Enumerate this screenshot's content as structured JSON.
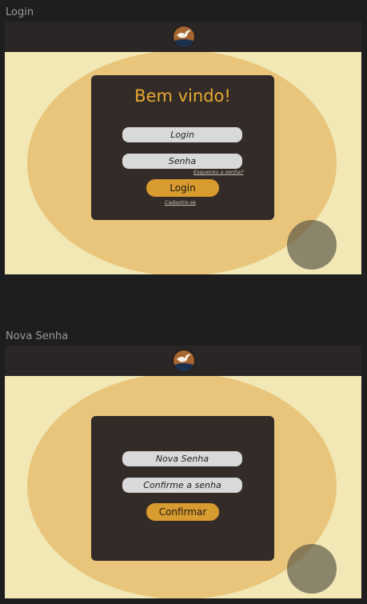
{
  "frames": [
    {
      "label": "Login",
      "card": {
        "title": "Bem vindo!",
        "login_placeholder": "Login",
        "password_placeholder": "Senha",
        "forgot_password": "Esqueceu a senha?",
        "login_button": "Login",
        "signup_link": "Cadastre-se"
      }
    },
    {
      "label": "Nova Senha",
      "card": {
        "new_password_placeholder": "Nova Senha",
        "confirm_password_placeholder": "Confirme a senha",
        "confirm_button": "Confirmar"
      }
    }
  ],
  "colors": {
    "page_background": "#1e1e1e",
    "top_bar": "#2a2626",
    "content_background": "#f2e8b6",
    "ellipse": "#e8c57a",
    "card": "#332b28",
    "accent": "#d89b2f",
    "title": "#e7aa2f",
    "field": "#d9d9d9"
  },
  "icons": {
    "logo": "dove-logo-icon"
  }
}
